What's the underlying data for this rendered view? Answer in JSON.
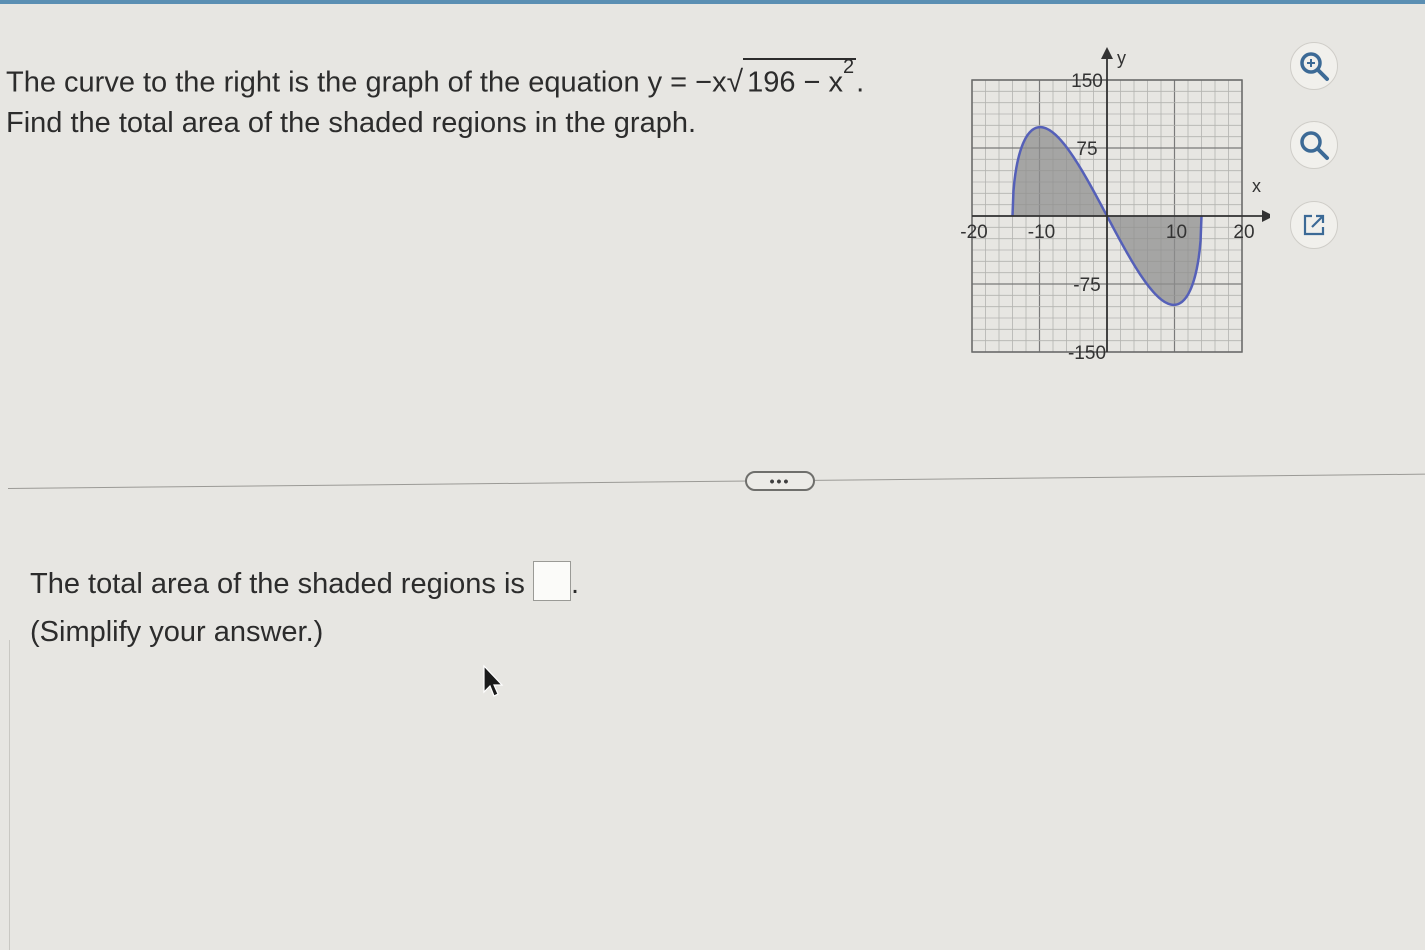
{
  "question": {
    "line1_text": "The curve to the right is the graph of the equation ",
    "equation": {
      "lhs": "y = −x",
      "radicand": "196 − x",
      "exponent": "2",
      "period": "."
    },
    "line2_text": "Find the total area of the shaded regions in the graph."
  },
  "graph": {
    "x_axis_label": "x",
    "y_axis_label": "y",
    "x_ticks": [
      "-20",
      "-10",
      "10",
      "20"
    ],
    "y_ticks": [
      "150",
      "75",
      "-75",
      "-150"
    ],
    "curve_color": "#5560b8",
    "shade_color": "#8f8f8f"
  },
  "chart_data": {
    "type": "line",
    "series": [
      {
        "x": [
          -14,
          -13,
          -12,
          -11,
          -10,
          -9,
          -8,
          -7,
          -6,
          -5,
          -4,
          -3,
          -2,
          -1,
          0,
          1,
          2,
          3,
          4,
          5,
          6,
          7,
          8,
          9,
          10,
          11,
          12,
          13,
          14
        ],
        "y": [
          0,
          67.6,
          86.5,
          95.2,
          98.0,
          96.5,
          91.9,
          84.9,
          75.9,
          65.4,
          53.7,
          41.0,
          27.7,
          14.0,
          0,
          -14.0,
          -27.7,
          -41.0,
          -53.7,
          -65.4,
          -75.9,
          -84.9,
          -91.9,
          -96.5,
          -98.0,
          -95.2,
          -86.5,
          -67.6,
          0
        ]
      }
    ],
    "shaded_regions": [
      [
        -14,
        0
      ],
      [
        0,
        14
      ]
    ],
    "xlim": [
      -20,
      20
    ],
    "ylim": [
      -150,
      150
    ],
    "grid": true
  },
  "toolbar": {
    "zoom_in": "zoom-in",
    "zoom_out": "zoom-out",
    "popout": "open-in-new-window"
  },
  "more_button": "•••",
  "answer": {
    "prompt": "The total area of the shaded regions is",
    "after_box": ".",
    "hint": "(Simplify your answer.)",
    "value": ""
  }
}
